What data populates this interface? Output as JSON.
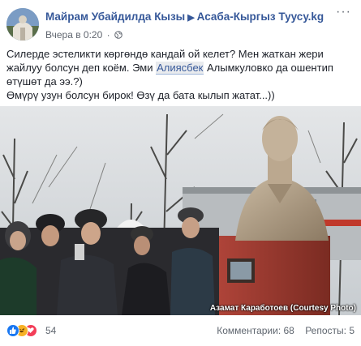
{
  "header": {
    "author": "Майрам Убайдилда Кызы",
    "group": "Асаба-Кыргыз Туусу.kg",
    "timestamp": "Вчера в 0:20",
    "separator": "·",
    "privacy_icon": "globe-icon",
    "more_icon": "ellipsis-icon"
  },
  "post": {
    "line1": "Силерде эстеликти көргөндө кандай ой келет? Мен жаткан жери жайлуу болсун деп коём. Эми ",
    "mention": "Алиясбек",
    "line1_tail": " Алымкуловко да ошентип өтүшөт да ээ.?)",
    "line2": "Өмүрү узун болсун бирок! Өзү да бата кылып жатат...))"
  },
  "photo": {
    "caption": "Азамат Каработоев (Courtesy Photo)"
  },
  "footer": {
    "reaction_icons": [
      "like-icon",
      "haha-icon",
      "love-icon"
    ],
    "reaction_count": "54",
    "comments": "Комментарии: 68",
    "reposts": "Репосты: 5"
  },
  "colors": {
    "link": "#365899",
    "like": "#1877f2",
    "haha": "#f7b125",
    "love": "#f33e58"
  }
}
